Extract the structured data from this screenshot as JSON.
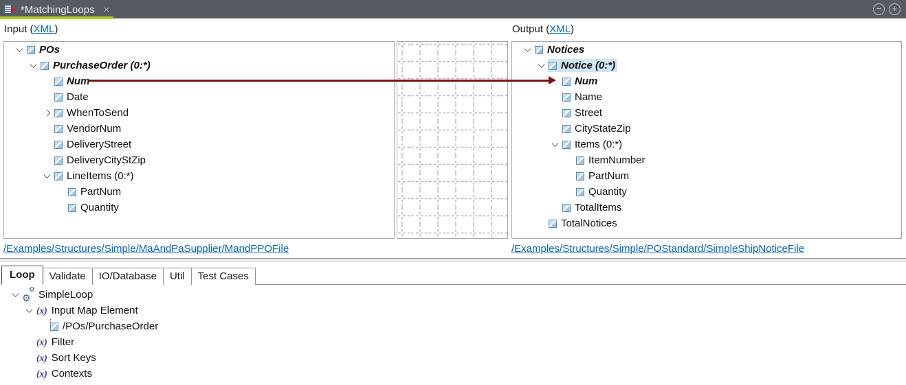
{
  "window": {
    "tab_title": "*MatchingLoops",
    "close_glyph": "×",
    "collapse_glyph": "−",
    "expand_glyph": "+"
  },
  "input_panel": {
    "header_prefix": "Input (",
    "header_link": "XML",
    "header_suffix": ")",
    "file_link": "/Examples/Structures/Simple/MaAndPaSupplier/MandPPOFile",
    "tree": [
      {
        "label": "POs",
        "depth": 0,
        "expander": "open",
        "icon": "element",
        "emph": true
      },
      {
        "label": "PurchaseOrder (0:*)",
        "depth": 1,
        "expander": "open",
        "icon": "element",
        "emph": true
      },
      {
        "label": "Num",
        "depth": 2,
        "icon": "element",
        "emph": true
      },
      {
        "label": "Date",
        "depth": 2,
        "icon": "element"
      },
      {
        "label": "WhenToSend",
        "depth": 2,
        "expander": "closed",
        "icon": "element"
      },
      {
        "label": "VendorNum",
        "depth": 2,
        "icon": "element"
      },
      {
        "label": "DeliveryStreet",
        "depth": 2,
        "icon": "element"
      },
      {
        "label": "DeliveryCityStZip",
        "depth": 2,
        "icon": "element"
      },
      {
        "label": "LineItems (0:*)",
        "depth": 2,
        "expander": "open",
        "icon": "element"
      },
      {
        "label": "PartNum",
        "depth": 3,
        "icon": "element"
      },
      {
        "label": "Quantity",
        "depth": 3,
        "icon": "element"
      }
    ]
  },
  "output_panel": {
    "header_prefix": "Output (",
    "header_link": "XML",
    "header_suffix": ")",
    "file_link": "/Examples/Structures/Simple/POStandard/SimpleShipNoticeFile",
    "tree": [
      {
        "label": "Notices",
        "depth": 0,
        "expander": "open",
        "icon": "element",
        "emph": true
      },
      {
        "label": "Notice (0:*)",
        "depth": 1,
        "expander": "open",
        "icon": "element",
        "emph": true,
        "selected": true
      },
      {
        "label": "Num",
        "depth": 2,
        "icon": "element",
        "emph": true
      },
      {
        "label": "Name",
        "depth": 2,
        "icon": "element"
      },
      {
        "label": "Street",
        "depth": 2,
        "icon": "element"
      },
      {
        "label": "CityStateZip",
        "depth": 2,
        "icon": "element"
      },
      {
        "label": "Items (0:*)",
        "depth": 2,
        "expander": "open",
        "icon": "element"
      },
      {
        "label": "ItemNumber",
        "depth": 3,
        "icon": "element"
      },
      {
        "label": "PartNum",
        "depth": 3,
        "icon": "element"
      },
      {
        "label": "Quantity",
        "depth": 3,
        "icon": "element"
      },
      {
        "label": "TotalItems",
        "depth": 2,
        "icon": "element"
      },
      {
        "label": "TotalNotices",
        "depth": 1,
        "icon": "element"
      }
    ]
  },
  "mapping": {
    "from_label": "Num",
    "to_label": "Num",
    "line_color": "#7f1111"
  },
  "bottom": {
    "tabs": [
      {
        "label": "Loop",
        "active": true
      },
      {
        "label": "Validate",
        "active": false
      },
      {
        "label": "IO/Database",
        "active": false
      },
      {
        "label": "Util",
        "active": false
      },
      {
        "label": "Test Cases",
        "active": false
      }
    ],
    "tree": [
      {
        "label": "SimpleLoop",
        "depth": 0,
        "expander": "open",
        "icon": "loop"
      },
      {
        "label": "Input Map Element",
        "depth": 1,
        "expander": "open",
        "icon": "expr"
      },
      {
        "label": "/POs/PurchaseOrder",
        "depth": 2,
        "icon": "mapped"
      },
      {
        "label": "Filter",
        "depth": 1,
        "icon": "expr"
      },
      {
        "label": "Sort Keys",
        "depth": 1,
        "icon": "expr"
      },
      {
        "label": "Contexts",
        "depth": 1,
        "icon": "expr"
      }
    ]
  },
  "colors": {
    "titlebar": "#565b62",
    "accent_green": "#b5cc1e",
    "mapping_line": "#7f1111",
    "link_blue": "#0563c1",
    "selection": "#cfe6f8"
  }
}
